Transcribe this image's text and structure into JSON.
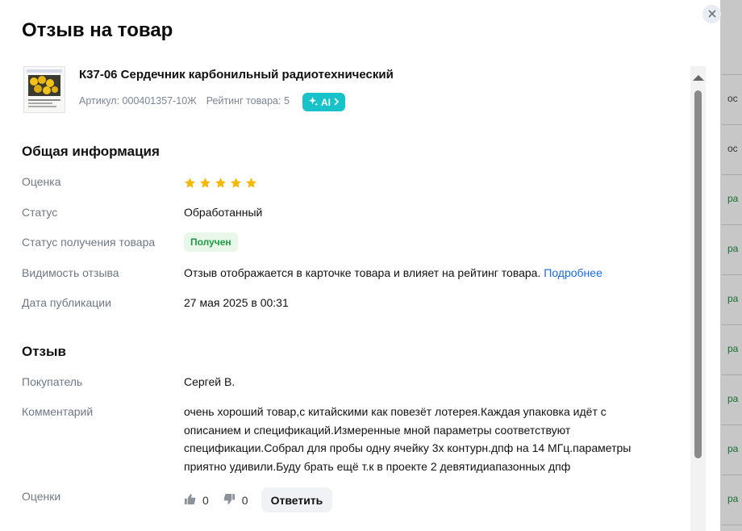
{
  "background": {
    "cells": [
      {
        "text": "ос",
        "tone": "grey"
      },
      {
        "text": "ос",
        "tone": "grey"
      },
      {
        "text": "ра",
        "tone": "green"
      },
      {
        "text": "ра",
        "tone": "green"
      },
      {
        "text": "ра",
        "tone": "green"
      },
      {
        "text": "ра",
        "tone": "green"
      },
      {
        "text": "ра",
        "tone": "green"
      },
      {
        "text": "ра",
        "tone": "green"
      },
      {
        "text": "ра",
        "tone": "green"
      }
    ]
  },
  "modal": {
    "title": "Отзыв на товар",
    "close_icon": "close-icon"
  },
  "product": {
    "name": "К37-06 Сердечник карбонильный радиотехнический",
    "article": "Артикул: 000401357-10Ж",
    "rating": "Рейтинг товара: 5",
    "ai_badge": "AI",
    "ai_icon": "sparkle-icon"
  },
  "general": {
    "title": "Общая информация",
    "rating_label": "Оценка",
    "rating_value": 5,
    "rating_max": 5,
    "status_label": "Статус",
    "status_value": "Обработанный",
    "receipt_label": "Статус получения товара",
    "receipt_value": "Получен",
    "visibility_label": "Видимость отзыва",
    "visibility_value": "Отзыв отображается в карточке товара и влияет на рейтинг товара.",
    "visibility_link": "Подробнее",
    "date_label": "Дата публикации",
    "date_value": "27 мая 2025 в 00:31"
  },
  "review": {
    "title": "Отзыв",
    "buyer_label": "Покупатель",
    "buyer_value": "Сергей В.",
    "comment_label": "Комментарий",
    "comment_value": "очень хороший товар,с китайскими как повезёт лотерея.Каждая упаковка идёт с описанием и спецификаций.Измеренные мной параметры соответствуют спецификации.Собрал для пробы одну ячейку 3х контурн.дпф на 14 МГц.параметры приятно удивили.Буду брать ещё т.к в проекте 2 девятидиапазонных дпф",
    "votes_label": "Оценки",
    "likes": "0",
    "dislikes": "0",
    "reply_button": "Ответить"
  },
  "colors": {
    "star": "#f5b800",
    "ai_badge": "#17c2c9",
    "received_text": "#1e9a43",
    "link": "#1a6be0"
  }
}
